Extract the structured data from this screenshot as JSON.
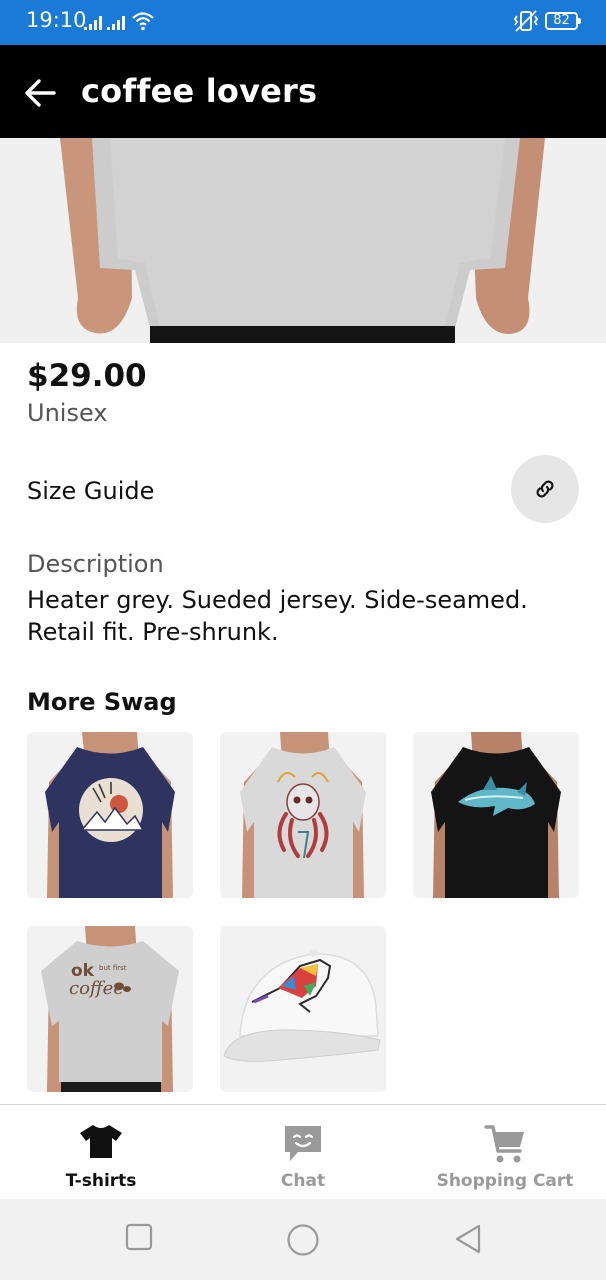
{
  "status_bar": {
    "time": "19:10",
    "battery": "82",
    "icons": [
      "signal-icon",
      "signal-icon",
      "wifi-icon",
      "vibrate-icon",
      "battery-icon"
    ]
  },
  "app_bar": {
    "title": "coffee lovers",
    "back_icon": "arrow-left-icon"
  },
  "product": {
    "price": "$29.00",
    "gender": "Unisex",
    "size_guide_label": "Size Guide",
    "size_guide_icon": "link-icon",
    "description_label": "Description",
    "description_text": "Heater grey. Sueded jersey. Side-seamed. Retail fit. Pre-shrunk."
  },
  "more_swag": {
    "title": "More Swag",
    "items": [
      {
        "kind": "t-shirt",
        "color": "#2f3360",
        "design": "moon-mountains"
      },
      {
        "kind": "t-shirt",
        "color": "#d9d9d9",
        "design": "octopus-skull"
      },
      {
        "kind": "t-shirt",
        "color": "#141414",
        "design": "orca"
      },
      {
        "kind": "t-shirt",
        "color": "#cfcfcf",
        "design": "ok-but-first-coffee",
        "print_text": [
          "ok",
          "but first",
          "coffee"
        ]
      },
      {
        "kind": "cap",
        "color": "#f3f3f3",
        "design": "colorful-cat"
      }
    ]
  },
  "bottom_nav": {
    "items": [
      {
        "label": "T-shirts",
        "icon": "tshirt-icon",
        "active": true
      },
      {
        "label": "Chat",
        "icon": "chat-icon",
        "active": false
      },
      {
        "label": "Shopping Cart",
        "icon": "cart-icon",
        "active": false
      }
    ]
  },
  "colors": {
    "status_bar": "#1a7ad8",
    "app_bar": "#000000",
    "active_nav": "#111111",
    "inactive_nav": "#9a9a9a"
  }
}
